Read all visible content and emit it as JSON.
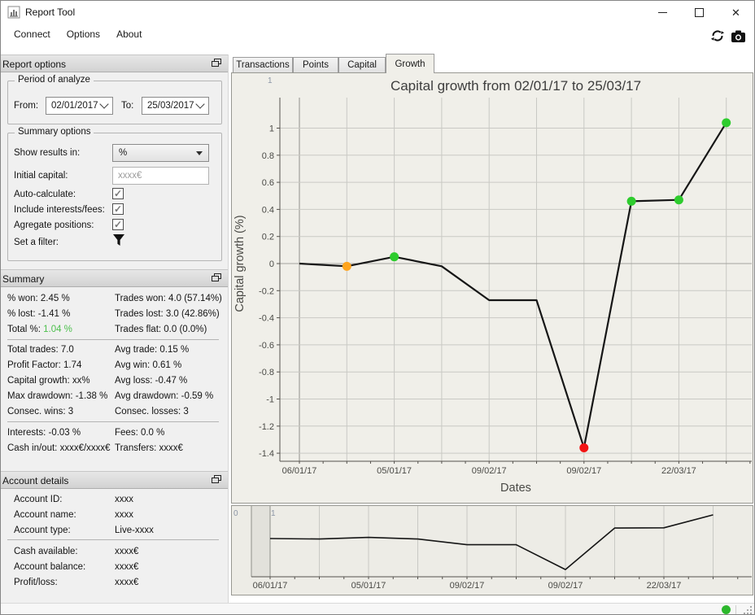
{
  "window": {
    "title": "Report Tool"
  },
  "menu": {
    "items": [
      "Connect",
      "Options",
      "About"
    ]
  },
  "toolbar": {
    "icons": [
      "refresh-icon",
      "camera-icon"
    ]
  },
  "report_options": {
    "title": "Report options",
    "period": {
      "legend": "Period of analyze",
      "from_label": "From:",
      "from_value": "02/01/2017",
      "to_label": "To:",
      "to_value": "25/03/2017"
    },
    "options": {
      "legend": "Summary options",
      "show_results_label": "Show results in:",
      "show_results_value": "%",
      "initial_capital_label": "Initial capital:",
      "initial_capital_placeholder": "xxxx€",
      "auto_calculate_label": "Auto-calculate:",
      "auto_calculate_checked": true,
      "include_label": "Include interests/fees:",
      "include_checked": true,
      "agregate_label": "Agregate positions:",
      "agregate_checked": true,
      "filter_label": "Set a filter:"
    }
  },
  "summary": {
    "title": "Summary",
    "groups": [
      {
        "rows": [
          {
            "left": "% won: 2.45 %",
            "right": "Trades won: 4.0 (57.14%)"
          },
          {
            "left": "% lost: -1.41 %",
            "right": "Trades lost: 3.0 (42.86%)"
          },
          {
            "left_label": "Total %: ",
            "left_value": "1.04 %",
            "right": "Trades flat: 0.0 (0.0%)"
          }
        ]
      },
      {
        "rows": [
          {
            "left": "Total trades: 7.0",
            "right": "Avg trade: 0.15 %"
          },
          {
            "left": "Profit Factor: 1.74",
            "right": "Avg win: 0.61 %"
          },
          {
            "left": "Capital growth: xx%",
            "right": "Avg loss: -0.47 %"
          },
          {
            "left": "Max drawdown: -1.38 %",
            "right": "Avg drawdown: -0.59 %"
          },
          {
            "left": "Consec. wins: 3",
            "right": "Consec. losses: 3"
          }
        ]
      },
      {
        "rows": [
          {
            "left": "Interests: -0.03 %",
            "right": "Fees: 0.0 %"
          },
          {
            "left": "Cash in/out: xxxx€/xxxx€",
            "right": "Transfers: xxxx€"
          }
        ]
      }
    ],
    "total_value_color": "#4ec04e"
  },
  "account": {
    "title": "Account details",
    "rows": [
      {
        "label": "Account ID:",
        "value": "xxxx"
      },
      {
        "label": "Account name:",
        "value": "xxxx"
      },
      {
        "label": "Account type:",
        "value": "Live-xxxx"
      },
      {
        "label": "Cash available:",
        "value": "xxxx€"
      },
      {
        "label": "Account balance:",
        "value": "xxxx€"
      },
      {
        "label": "Profit/loss:",
        "value": "xxxx€"
      }
    ]
  },
  "tabs": {
    "items": [
      "Transactions",
      "Points",
      "Capital",
      "Growth"
    ],
    "active": "Growth"
  },
  "chart_data": {
    "type": "line",
    "title": "Capital growth from 02/01/17 to 25/03/17",
    "xlabel": "Dates",
    "ylabel": "Capital growth (%)",
    "ylim": [
      -1.5,
      1.15
    ],
    "yticks": [
      1,
      0.8,
      0.6,
      0.4,
      0.2,
      0,
      -0.2,
      -0.4,
      -0.6,
      -0.8,
      -1,
      -1.2,
      -1.4
    ],
    "x_tick_labels": [
      "06/01/17",
      "05/01/17",
      "09/02/17",
      "09/02/17",
      "22/03/17"
    ],
    "x_tick_positions": [
      0,
      2,
      4,
      6,
      8
    ],
    "points": [
      {
        "value": 0.0,
        "marker": null
      },
      {
        "value": -0.02,
        "marker": "orange"
      },
      {
        "value": 0.05,
        "marker": "green"
      },
      {
        "value": -0.02,
        "marker": null
      },
      {
        "value": -0.27,
        "marker": null
      },
      {
        "value": -0.27,
        "marker": null
      },
      {
        "value": -1.36,
        "marker": "red"
      },
      {
        "value": 0.46,
        "marker": "green"
      },
      {
        "value": 0.47,
        "marker": "green"
      },
      {
        "value": 1.04,
        "marker": "green"
      }
    ],
    "marker_colors": {
      "green": "#2ecc2e",
      "orange": "#ffa41c",
      "red": "#f21414"
    },
    "line_color": "#161616",
    "grid_color": "#c9c9c4",
    "stray_top_label": "1",
    "overview": {
      "stray_labels": [
        "0",
        "1"
      ],
      "band_color": "#e2e1db",
      "grid_on": true
    },
    "legend": "none"
  },
  "status_bar": {
    "connection_dot_color": "#2db82d"
  }
}
